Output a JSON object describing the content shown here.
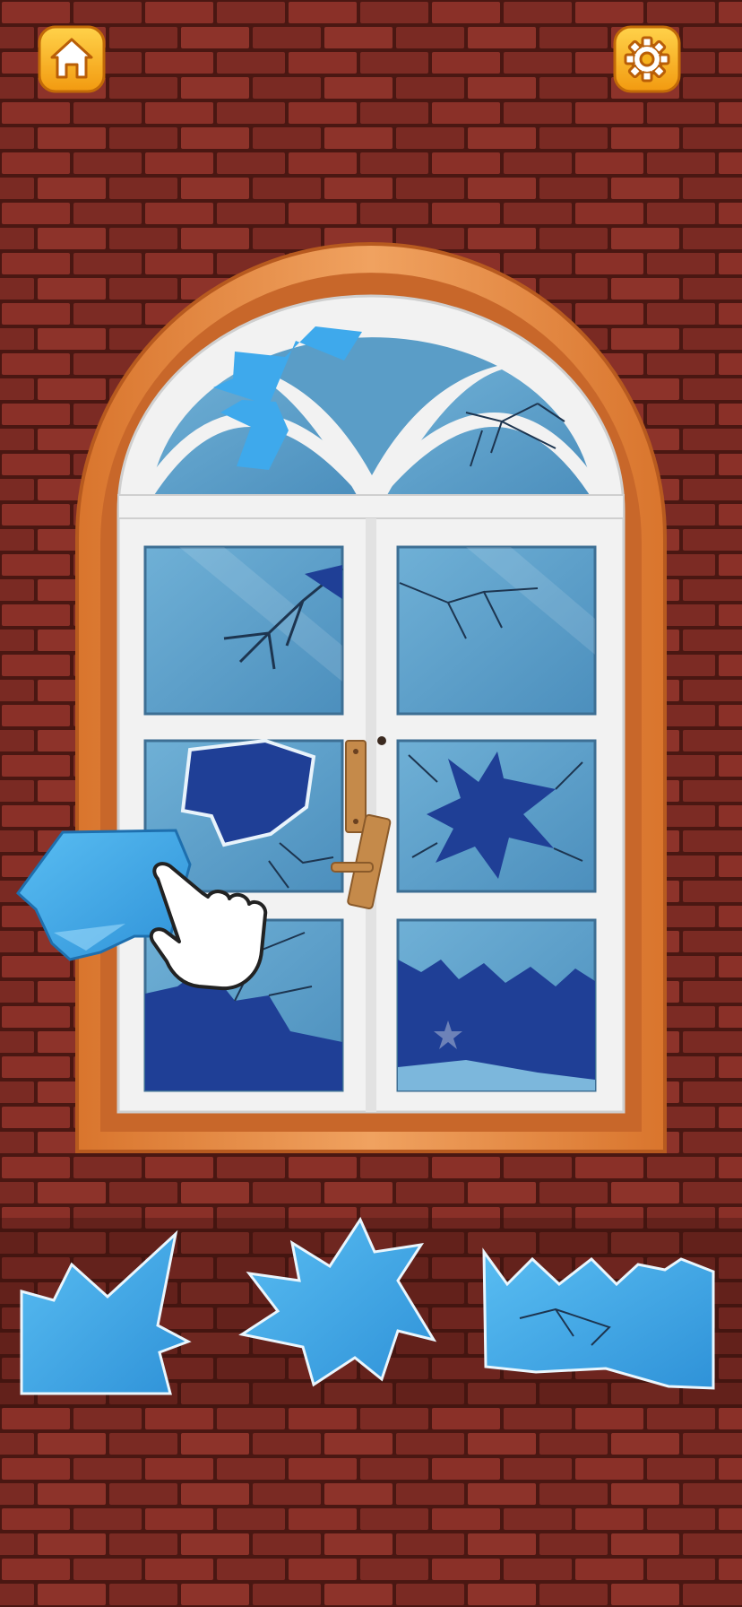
{
  "game": {
    "scene": "broken-window-repair",
    "wall_color": "#7a2a22",
    "mortar_color": "#4a1712",
    "glass_color": "#5b9cc4",
    "hole_color": "#1f3f96",
    "piece_color": "#3aa6e6",
    "frame_color": "#e88b3d",
    "sash_color": "#f2f2f2"
  },
  "toolbar": {
    "home_icon": "home-icon",
    "settings_icon": "gear-icon",
    "button_color": "#f5b21e"
  },
  "tray": {
    "pieces": [
      {
        "name": "shard-arrow",
        "color": "#3aa6e6"
      },
      {
        "name": "shard-star",
        "color": "#3aa6e6"
      },
      {
        "name": "shard-strip",
        "color": "#3aa6e6"
      }
    ]
  },
  "dragged_piece": {
    "name": "shard-hexagon",
    "color": "#3aa6e6"
  },
  "hand_pointer": {
    "icon": "pointing-hand-icon"
  }
}
